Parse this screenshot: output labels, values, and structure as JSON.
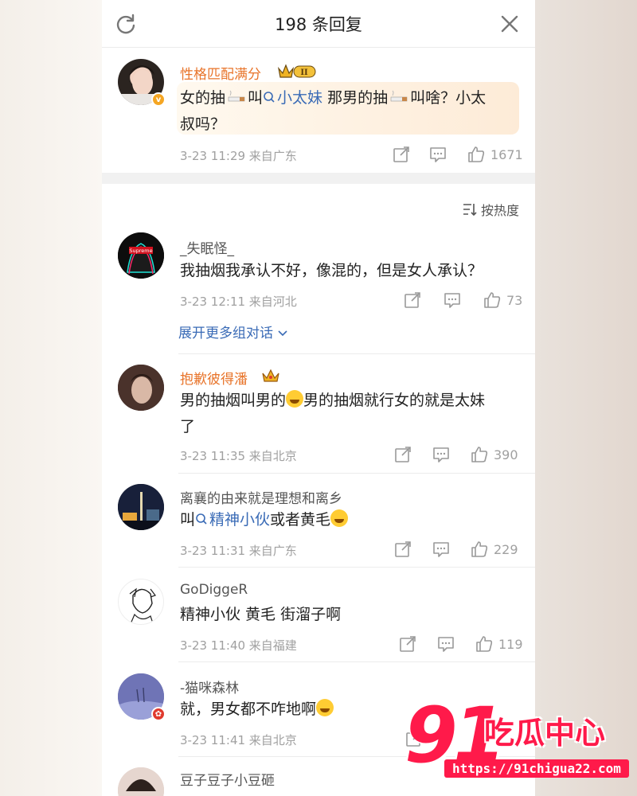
{
  "header": {
    "title": "198 条回复"
  },
  "main_post": {
    "username": "性格匹配满分",
    "level_badge": "II",
    "text_parts": [
      "女的抽",
      "叫",
      "小太妹",
      " 那男的抽",
      "叫啥？小太",
      "叔吗？"
    ],
    "meta": "3-23 11:29  来自广东",
    "likes": "1671"
  },
  "sort_label": "按热度",
  "comments": [
    {
      "username": "_失眠怪_",
      "text": "我抽烟我承认不好，像混的，但是女人承认？",
      "meta": "3-23 12:11  来自河北",
      "likes": "73",
      "expand": "展开更多组对话"
    },
    {
      "username": "抱歉彼得潘",
      "text_a": "男的抽烟叫男的",
      "text_b": "男的抽烟就行女的就是太妹",
      "text_c": "了",
      "meta": "3-23 11:35  来自北京",
      "likes": "390"
    },
    {
      "username": "离襄的由来就是理想和离乡",
      "text_a": "叫",
      "link": "精神小伙",
      "text_b": "或者黄毛",
      "meta": "3-23 11:31  来自广东",
      "likes": "229"
    },
    {
      "username": "GoDiggeR",
      "text": "精神小伙  黄毛  街溜子啊",
      "meta": "3-23 11:40  来自福建",
      "likes": "119"
    },
    {
      "username": "-猫咪森林",
      "text": "就，男女都不咋地啊",
      "meta": "3-23 11:41  来自北京"
    },
    {
      "username": "豆子豆子小豆砸"
    }
  ],
  "watermark": {
    "number": "91",
    "name": "吃瓜中心",
    "url": "https://91chigua22.com"
  },
  "colors": {
    "accent_orange": "#e8742a",
    "link_blue": "#3a6bb6",
    "watermark_red": "#ff1a4a"
  }
}
